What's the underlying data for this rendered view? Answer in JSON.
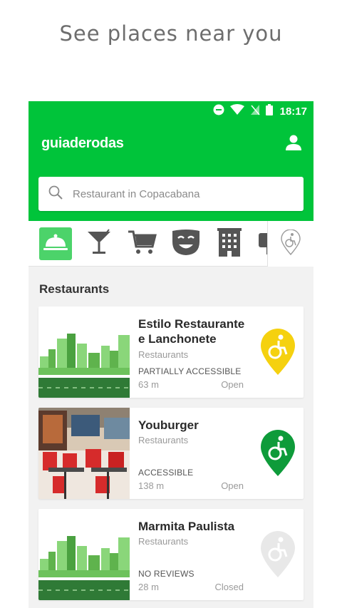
{
  "headline": "See places near you",
  "status": {
    "time": "18:17"
  },
  "appbar": {
    "title": "guiaderodas"
  },
  "search": {
    "placeholder": "Restaurant in Copacabana"
  },
  "categories": [
    "restaurant",
    "bar",
    "shopping",
    "entertainment",
    "hotel",
    "more"
  ],
  "section": {
    "title": "Restaurants"
  },
  "colors": {
    "brand": "#00c43a",
    "partial": "#f5d10f",
    "accessible": "#0e9b3a",
    "no_reviews": "#e8e8e8"
  },
  "places": [
    {
      "name": "Estilo Restaurante e Lanchonete",
      "category": "Restaurants",
      "accessibility": "PARTIALLY ACCESSIBLE",
      "distance": "63 m",
      "status": "Open",
      "pin": "partial"
    },
    {
      "name": "Youburger",
      "category": "Restaurants",
      "accessibility": "ACCESSIBLE",
      "distance": "138 m",
      "status": "Open",
      "pin": "accessible"
    },
    {
      "name": "Marmita Paulista",
      "category": "Restaurants",
      "accessibility": "NO REVIEWS",
      "distance": "28 m",
      "status": "Closed",
      "pin": "no-reviews"
    }
  ]
}
